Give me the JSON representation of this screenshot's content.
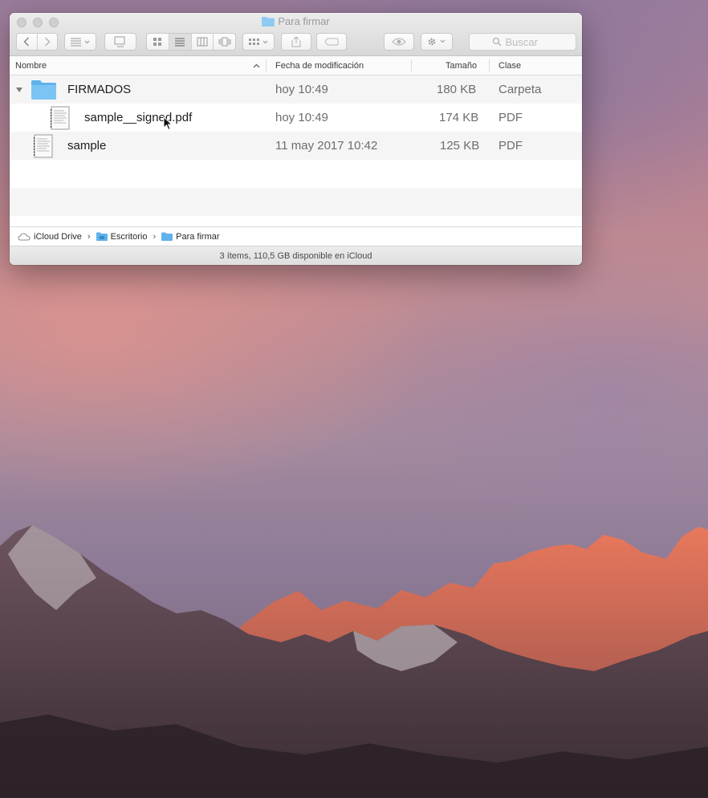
{
  "window": {
    "title": "Para firmar",
    "search_placeholder": "Buscar"
  },
  "columns": {
    "name": "Nombre",
    "modified": "Fecha de modificación",
    "size": "Tamaño",
    "kind": "Clase"
  },
  "rows": [
    {
      "name": "FIRMADOS",
      "modified": "hoy 10:49",
      "size": "180 KB",
      "kind": "Carpeta",
      "icon": "folder-icon",
      "expanded": true
    },
    {
      "name": "sample__signed.pdf",
      "modified": "hoy 10:49",
      "size": "174 KB",
      "kind": "PDF",
      "icon": "pdf-document-icon"
    },
    {
      "name": "sample",
      "modified": "11 may 2017 10:42",
      "size": "125 KB",
      "kind": "PDF",
      "icon": "pdf-document-icon"
    }
  ],
  "pathbar": {
    "items": [
      "iCloud Drive",
      "Escritorio",
      "Para firmar"
    ]
  },
  "status": "3 ítems, 110,5 GB disponible en iCloud",
  "colors": {
    "folder_blue": "#64b8f0",
    "selection_gray": "#f5f5f5"
  }
}
